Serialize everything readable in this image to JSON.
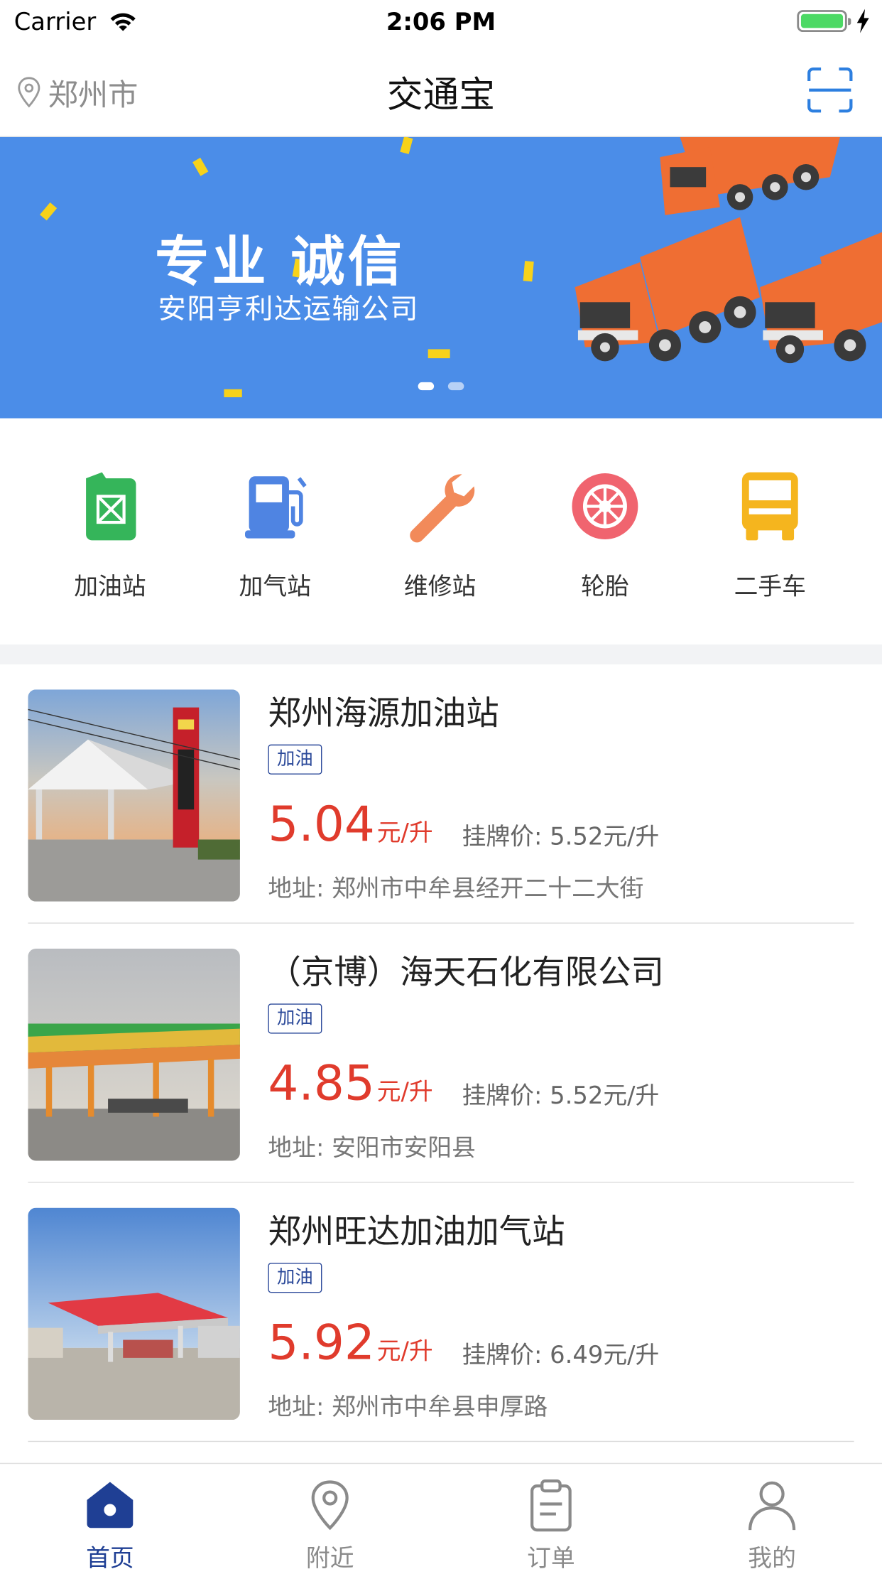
{
  "status_bar": {
    "carrier": "Carrier",
    "time": "2:06 PM"
  },
  "nav": {
    "location": "郑州市",
    "title": "交通宝"
  },
  "banner": {
    "title": "专业  诚信",
    "subtitle": "安阳亨利达运输公司",
    "page_count": 2,
    "active_page": 1
  },
  "quick_menu": [
    {
      "label": "加油站",
      "icon": "fuel-can-icon",
      "color": "#35b55a"
    },
    {
      "label": "加气站",
      "icon": "gas-pump-icon",
      "color": "#4f84e2"
    },
    {
      "label": "维修站",
      "icon": "wrench-icon",
      "color": "#f28a5a"
    },
    {
      "label": "轮胎",
      "icon": "tire-icon",
      "color": "#f0646f"
    },
    {
      "label": "二手车",
      "icon": "truck-icon",
      "color": "#f5b51e"
    }
  ],
  "stations": [
    {
      "name": "郑州海源加油站",
      "tag": "加油",
      "price": "5.04",
      "price_unit": "元/升",
      "list_price": "挂牌价: 5.52元/升",
      "address": "地址: 郑州市中牟县经开二十二大街"
    },
    {
      "name": "（京博）海天石化有限公司",
      "tag": "加油",
      "price": "4.85",
      "price_unit": "元/升",
      "list_price": "挂牌价: 5.52元/升",
      "address": "地址: 安阳市安阳县"
    },
    {
      "name": "郑州旺达加油加气站",
      "tag": "加油",
      "price": "5.92",
      "price_unit": "元/升",
      "list_price": "挂牌价: 6.49元/升",
      "address": "地址: 郑州市中牟县申厚路"
    }
  ],
  "tab_bar": [
    {
      "label": "首页",
      "icon": "home-icon",
      "active": true
    },
    {
      "label": "附近",
      "icon": "location-pin-icon",
      "active": false
    },
    {
      "label": "订单",
      "icon": "clipboard-icon",
      "active": false
    },
    {
      "label": "我的",
      "icon": "user-icon",
      "active": false
    }
  ],
  "colors": {
    "accent": "#1f3f94",
    "price": "#e03b2c",
    "banner": "#4b8de8"
  }
}
